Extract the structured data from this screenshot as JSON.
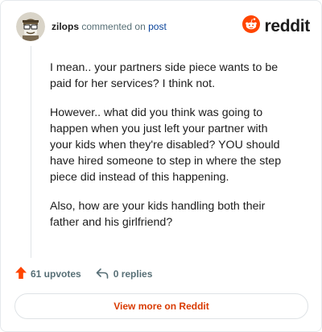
{
  "comment": {
    "username": "zilops",
    "commented_on_text": "commented on",
    "post_link_text": "post",
    "paragraphs": [
      "I mean.. your partners side piece wants to be paid for her services? I think not.",
      "However.. what did you think was going to happen when you just left your partner with your kids when they're disabled? YOU should have hired someone to step in where the step piece did instead of this happening.",
      "Also, how are your kids handling both their father and his girlfriend?"
    ]
  },
  "brand": {
    "name": "reddit",
    "icon": "reddit-snoo-icon",
    "color": "#ff4500"
  },
  "actions": {
    "upvotes_label": "61 upvotes",
    "replies_label": "0 replies",
    "upvote_icon": "upvote-arrow-icon",
    "reply_icon": "reply-arrow-icon",
    "upvote_color": "#ff4500"
  },
  "view_more_label": "View more on Reddit",
  "colors": {
    "accent": "#d93a00",
    "link": "#0a449b",
    "muted_text": "#576f76",
    "text": "#1c1c1c"
  }
}
